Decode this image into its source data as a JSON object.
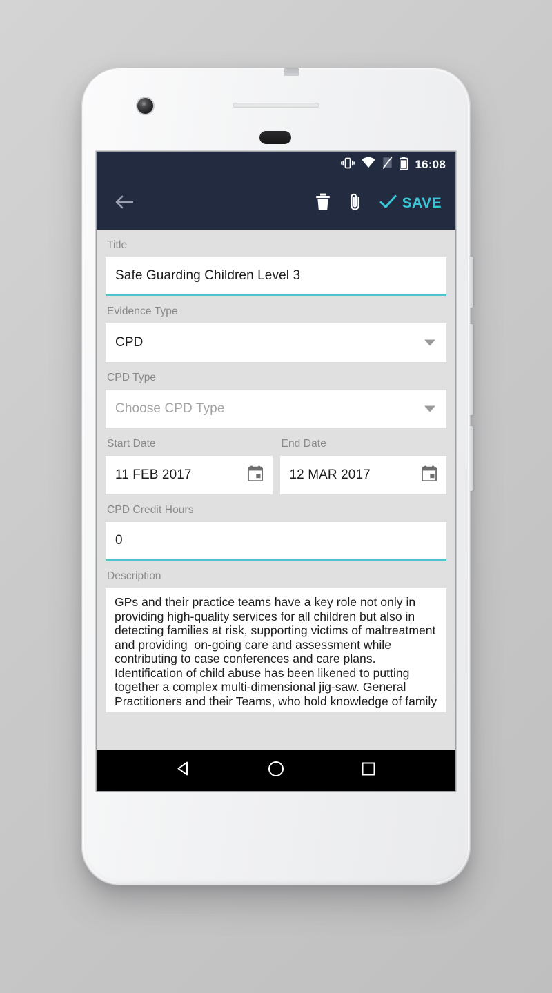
{
  "status_bar": {
    "time": "16:08",
    "icons": [
      "vibrate-icon",
      "wifi-icon",
      "no-sim-icon",
      "battery-icon"
    ]
  },
  "app_bar": {
    "back_icon": "back-arrow-icon",
    "delete_icon": "trash-icon",
    "attach_icon": "paperclip-icon",
    "save_label": "SAVE",
    "save_icon": "checkmark-icon",
    "background_color": "#232b40",
    "accent_color": "#39c6d6"
  },
  "form": {
    "title": {
      "label": "Title",
      "value": "Safe Guarding Children Level 3",
      "focused": true
    },
    "evidence_type": {
      "label": "Evidence Type",
      "value": "CPD",
      "focused": false
    },
    "cpd_type": {
      "label": "CPD Type",
      "placeholder": "Choose CPD Type",
      "value": "",
      "focused": false
    },
    "start_date": {
      "label": "Start Date",
      "value": "11 FEB 2017"
    },
    "end_date": {
      "label": "End Date",
      "value": "12 MAR 2017"
    },
    "credit_hours": {
      "label": "CPD Credit Hours",
      "value": "0",
      "focused": true
    },
    "description": {
      "label": "Description",
      "value": "GPs and their practice teams have a key role not only in providing high-quality services for all children but also in detecting families at risk, supporting victims of maltreatment and providing  on-going care and assessment while contributing to case conferences and care plans. Identification of child abuse has been likened to putting together a complex multi-dimensional jig-saw. General Practitioners and their Teams, who hold knowledge of family"
    },
    "underline_color": "#4dc4ce",
    "background_color": "#e0e0e0"
  },
  "nav_bar": {
    "back_label": "back-triangle-icon",
    "home_label": "home-circle-icon",
    "recents_label": "recents-square-icon",
    "background_color": "#000000"
  }
}
